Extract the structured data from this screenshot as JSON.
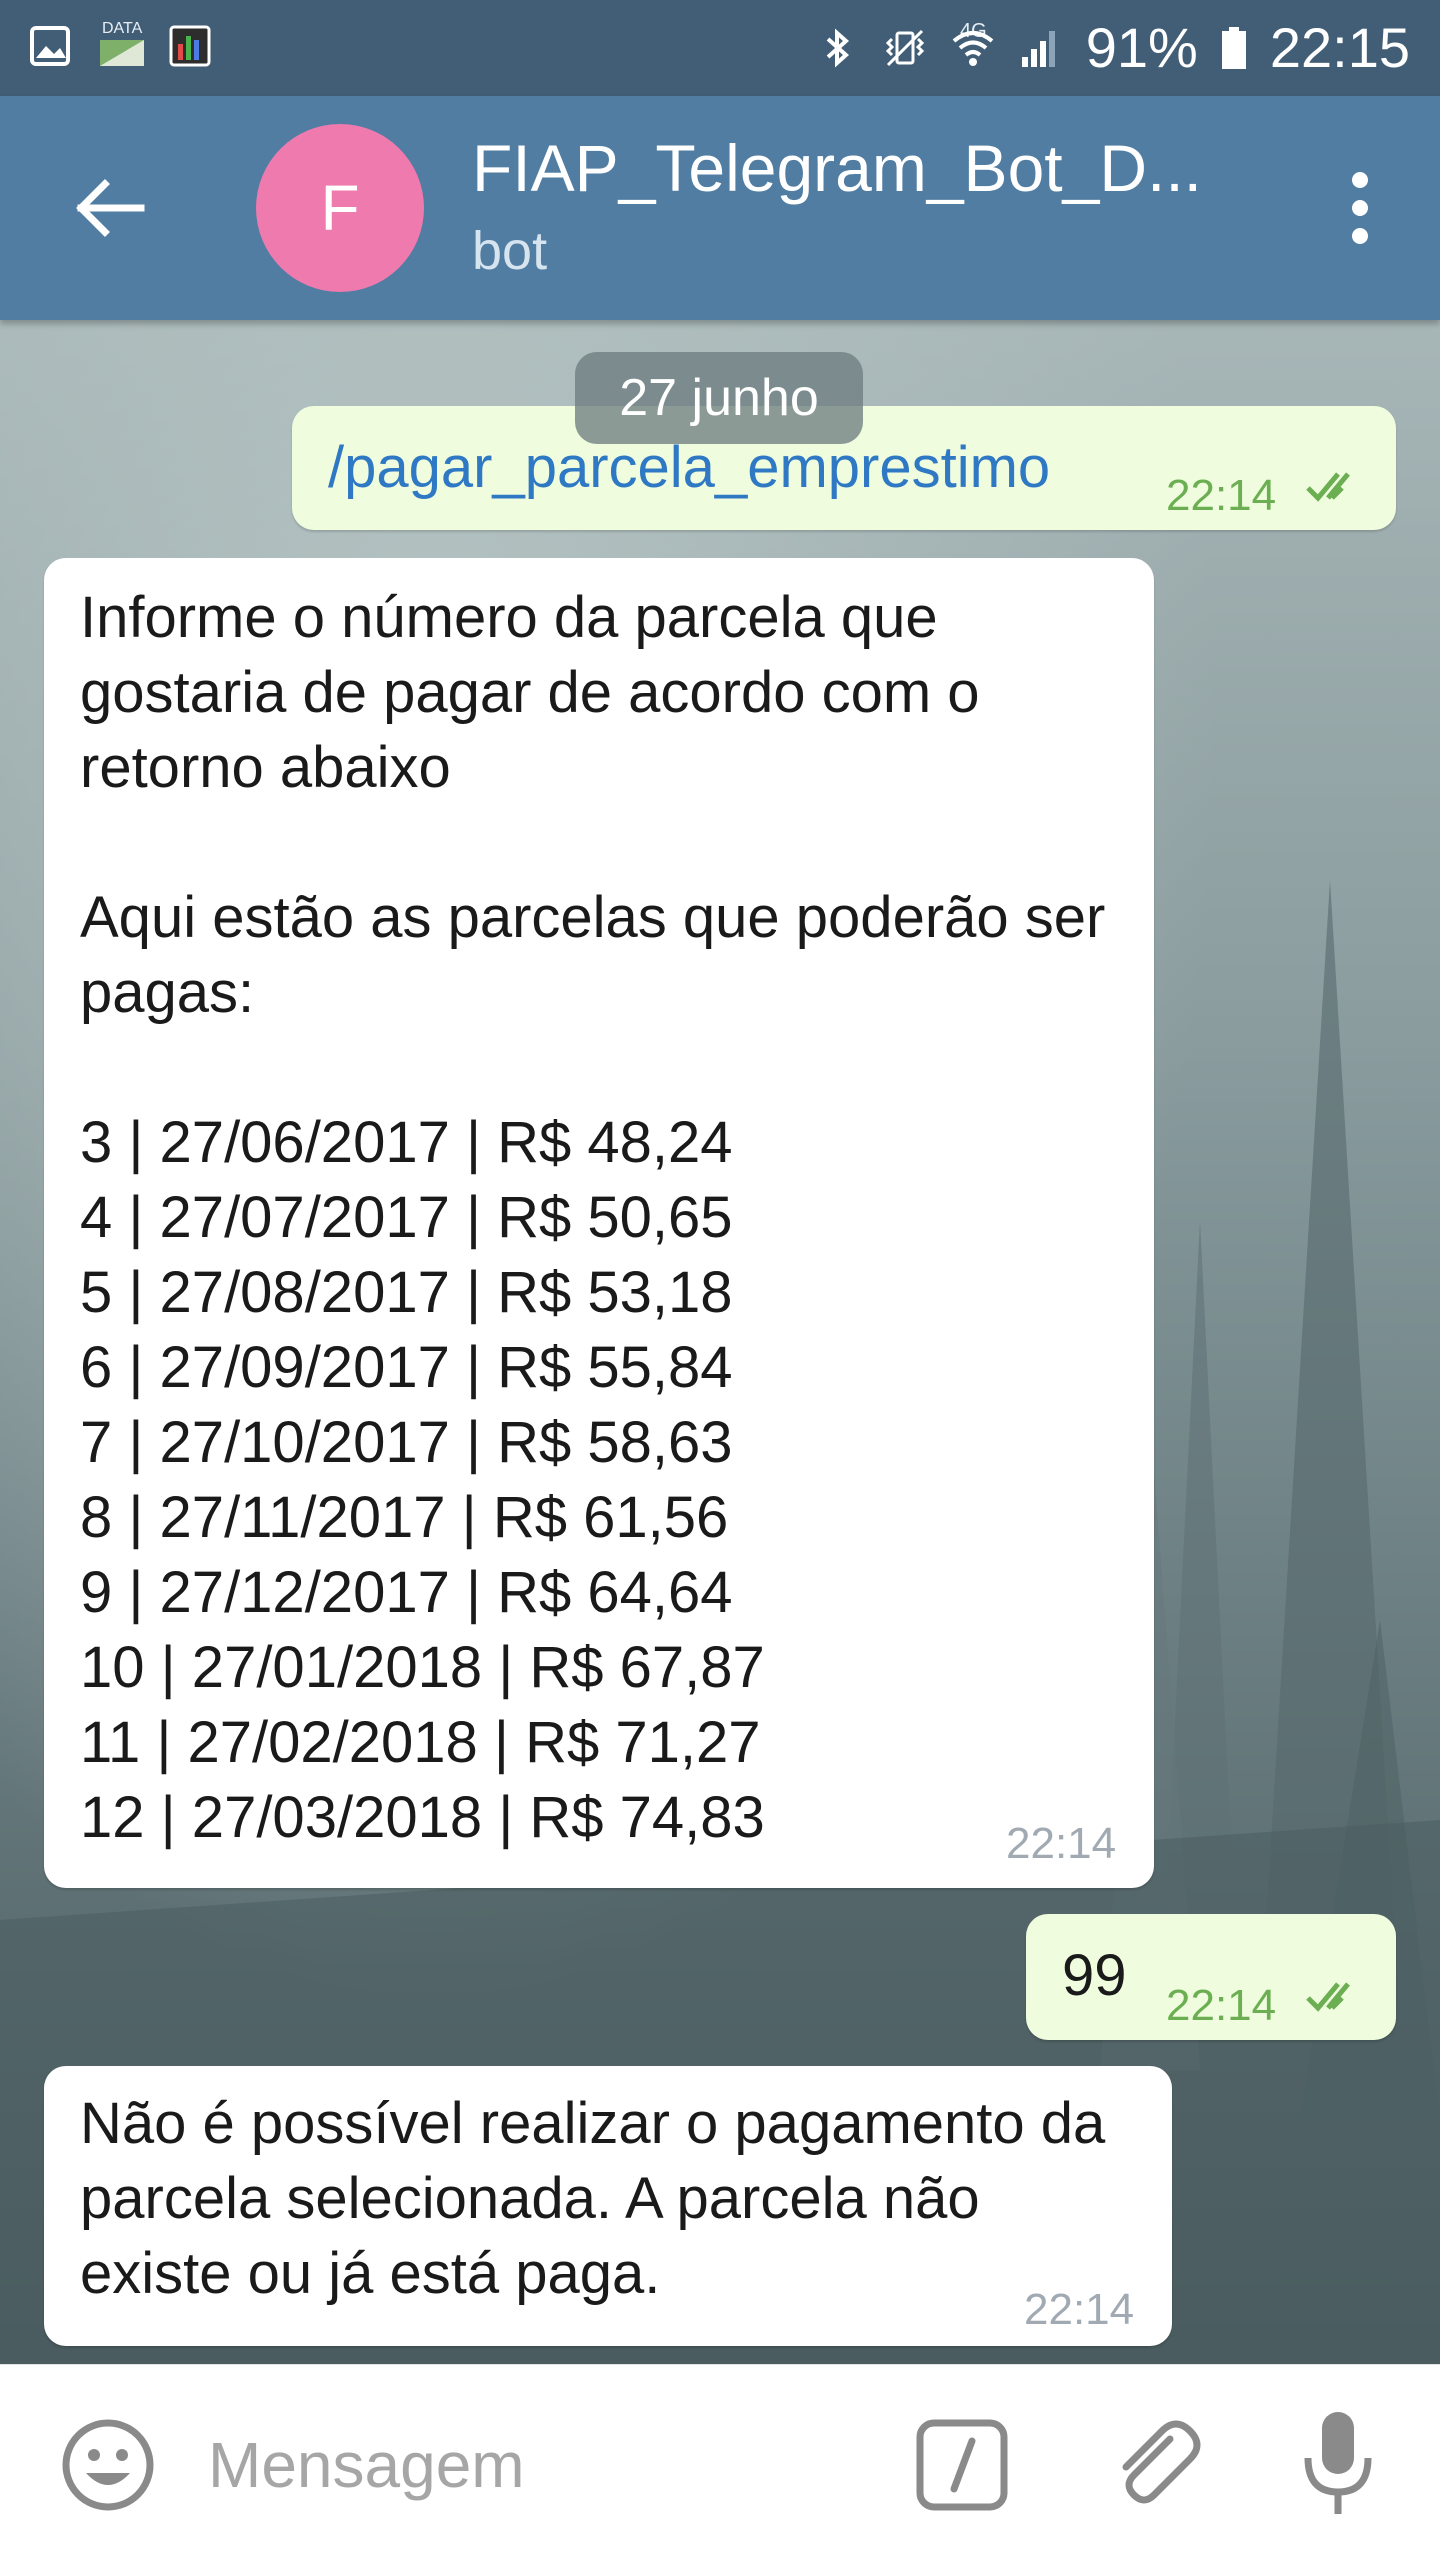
{
  "status_bar": {
    "left_icons": [
      "image-icon",
      "data-icon",
      "monitor-icon"
    ],
    "data_label": "DATA",
    "network_label": "4G",
    "battery_percent": "91%",
    "time": "22:15",
    "right_icons": [
      "bluetooth-icon",
      "vibrate-icon",
      "wifi-icon",
      "signal-icon",
      "battery-icon"
    ]
  },
  "toolbar": {
    "avatar_letter": "F",
    "title": "FIAP_Telegram_Bot_D...",
    "subtitle": "bot",
    "colors": {
      "toolbar": "#517da2",
      "avatar": "#ee7aae"
    }
  },
  "chat": {
    "date_separator": "27 junho",
    "messages": [
      {
        "direction": "out",
        "text": "/pagar_parcela_emprestimo",
        "time": "22:14",
        "status": "read-double-check"
      },
      {
        "direction": "in",
        "text": "Informe o número da parcela que gostaria de pagar de acordo com o retorno abaixo\n\nAqui estão as parcelas que poderão ser pagas:\n\n3 | 27/06/2017 | R$ 48,24\n4 | 27/07/2017 | R$ 50,65\n5 | 27/08/2017 | R$ 53,18\n6 | 27/09/2017 | R$ 55,84\n7 | 27/10/2017 | R$ 58,63\n8 | 27/11/2017 | R$ 61,56\n9 | 27/12/2017 | R$ 64,64\n10 | 27/01/2018 | R$ 67,87\n11 | 27/02/2018 | R$ 71,27\n12 | 27/03/2018 | R$ 74,83",
        "time": "22:14"
      },
      {
        "direction": "out",
        "text": "99",
        "time": "22:14",
        "status": "read-double-check"
      },
      {
        "direction": "in",
        "text": "Não é possível realizar o pagamento da parcela selecionada. A parcela não existe ou já está paga.",
        "time": "22:14"
      }
    ]
  },
  "input_bar": {
    "placeholder": "Mensagem",
    "icons": [
      "emoji-icon",
      "bot-command-icon",
      "attach-icon",
      "microphone-icon"
    ]
  }
}
